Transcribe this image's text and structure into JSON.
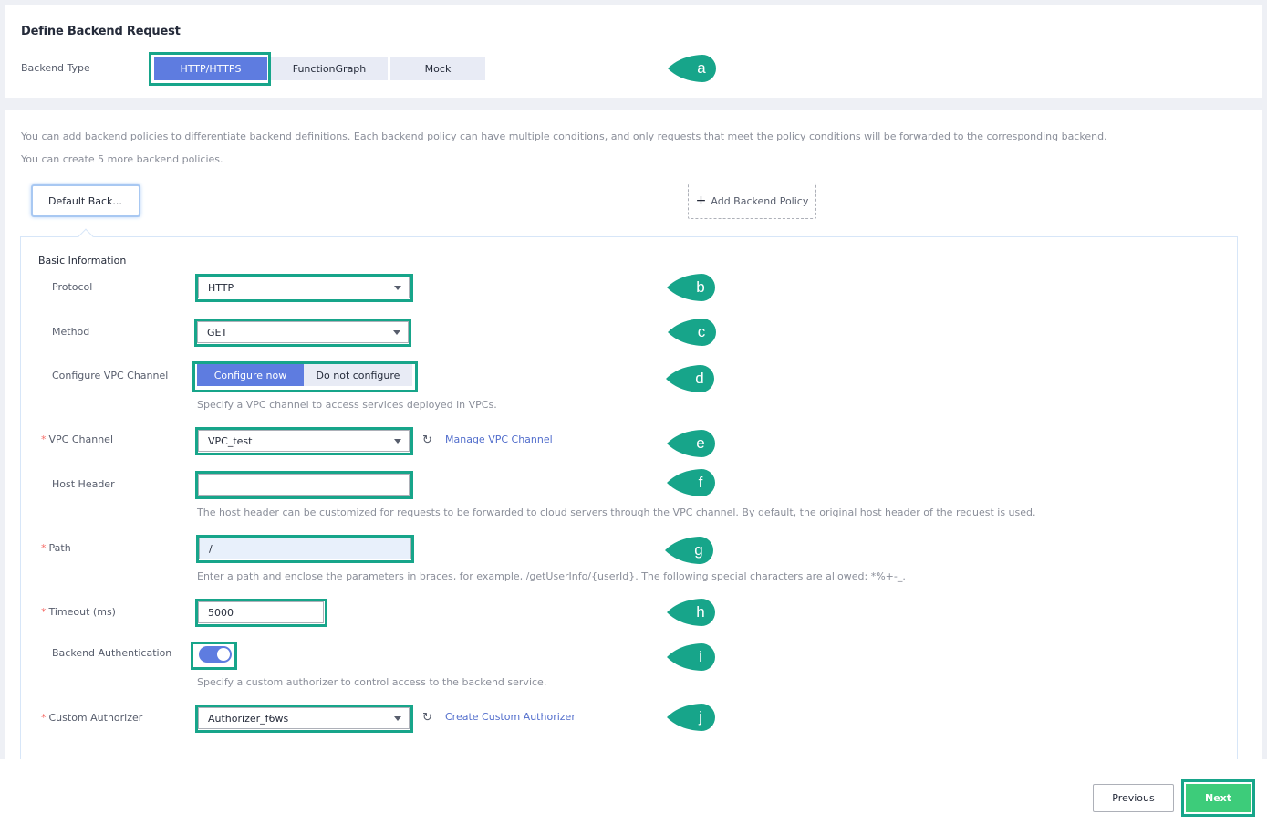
{
  "header": {
    "title": "Define Backend Request",
    "backend_type_label": "Backend Type",
    "backend_types": [
      {
        "label": "HTTP/HTTPS",
        "active": true
      },
      {
        "label": "FunctionGraph",
        "active": false
      },
      {
        "label": "Mock",
        "active": false
      }
    ]
  },
  "policies": {
    "info_line1": "You can add backend policies to differentiate backend definitions. Each backend policy can have multiple conditions, and only requests that meet the policy conditions will be forwarded to the corresponding backend.",
    "info_line2": "You can create 5 more backend policies.",
    "default_tab": "Default Back...",
    "add_button": "Add Backend Policy",
    "add_icon": "plus-icon"
  },
  "form": {
    "section_title": "Basic Information",
    "protocol": {
      "label": "Protocol",
      "value": "HTTP"
    },
    "method": {
      "label": "Method",
      "value": "GET"
    },
    "vpc_config": {
      "label": "Configure VPC Channel",
      "options": [
        {
          "label": "Configure now",
          "active": true
        },
        {
          "label": "Do not configure",
          "active": false
        }
      ],
      "hint": "Specify a VPC channel to access services deployed in VPCs."
    },
    "vpc_channel": {
      "label": "VPC Channel",
      "required": true,
      "value": "VPC_test",
      "link": "Manage VPC Channel",
      "refresh_icon": "refresh-icon"
    },
    "host_header": {
      "label": "Host Header",
      "value": "",
      "hint": "The host header can be customized for requests to be forwarded to cloud servers through the VPC channel. By default, the original host header of the request is used."
    },
    "path": {
      "label": "Path",
      "required": true,
      "value": "/",
      "hint": "Enter a path and enclose the parameters in braces, for example, /getUserInfo/{userId}. The following special characters are allowed: *%+-_."
    },
    "timeout": {
      "label": "Timeout (ms)",
      "required": true,
      "value": "5000"
    },
    "backend_auth": {
      "label": "Backend Authentication",
      "enabled": true,
      "hint": "Specify a custom authorizer to control access to the backend service."
    },
    "custom_authorizer": {
      "label": "Custom Authorizer",
      "required": true,
      "value": "Authorizer_f6ws",
      "link": "Create Custom Authorizer",
      "refresh_icon": "refresh-icon"
    }
  },
  "callouts": [
    "a",
    "b",
    "c",
    "d",
    "e",
    "f",
    "g",
    "h",
    "i",
    "j"
  ],
  "colors": {
    "accent": "#5e7ce0",
    "highlight": "#17a58a",
    "next": "#3dcc7a",
    "link": "#526ecc",
    "required": "#f66f6a"
  },
  "footer": {
    "previous": "Previous",
    "next": "Next"
  }
}
